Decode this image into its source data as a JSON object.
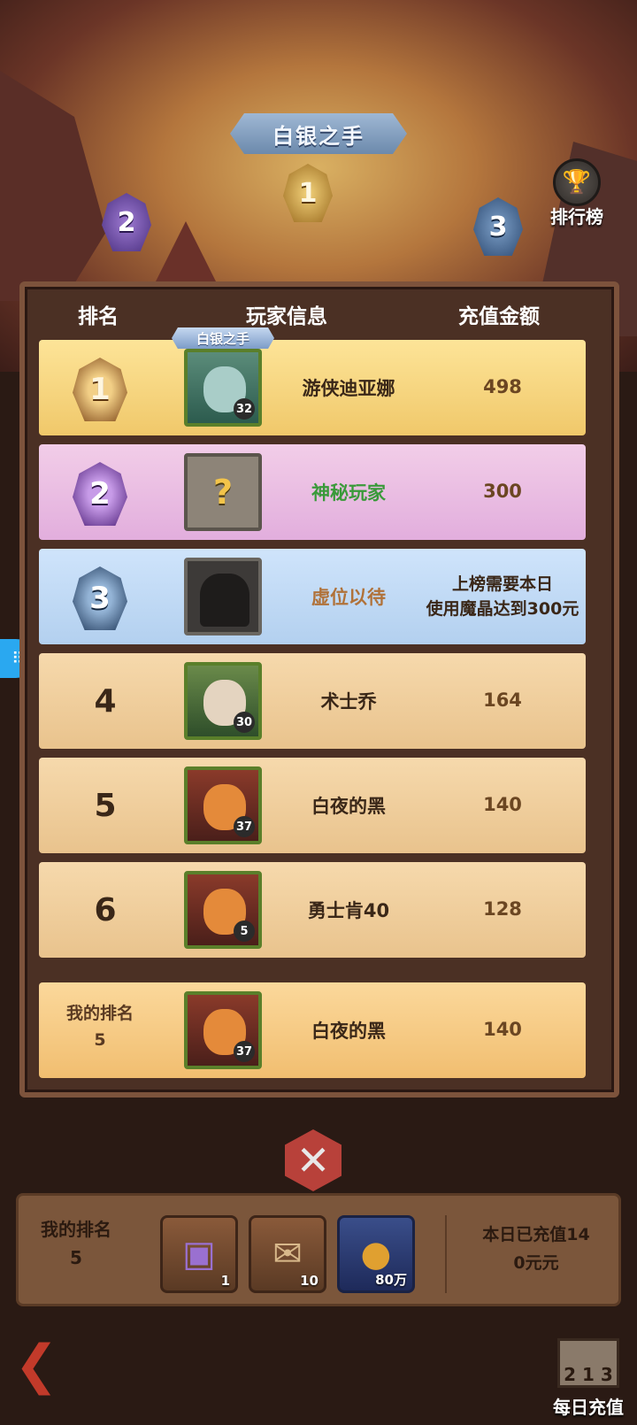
{
  "header": {
    "banner": "白银之手",
    "podium_ranks": [
      "1",
      "2",
      "3"
    ],
    "leaderboard_label": "排行榜"
  },
  "table": {
    "columns": [
      "排名",
      "玩家信息",
      "充值金额"
    ],
    "rows": [
      {
        "rank": "1",
        "name": "游侠迪亚娜",
        "amount": "498",
        "level": "32",
        "title": "白银之手"
      },
      {
        "rank": "2",
        "name": "神秘玩家",
        "amount": "300",
        "avatar": "?"
      },
      {
        "rank": "3",
        "name": "虚位以待",
        "amount_line1": "上榜需要本日",
        "amount_line2": "使用魔晶达到300元"
      },
      {
        "rank": "4",
        "name": "术士乔",
        "amount": "164",
        "level": "30"
      },
      {
        "rank": "5",
        "name": "白夜的黑",
        "amount": "140",
        "level": "37"
      },
      {
        "rank": "6",
        "name": "勇士肯40",
        "amount": "128",
        "level": "5"
      }
    ],
    "mine": {
      "label": "我的排名",
      "rank": "5",
      "name": "白夜的黑",
      "amount": "140",
      "level": "37"
    }
  },
  "rewards": {
    "my_rank_label": "我的排名",
    "my_rank": "5",
    "items": [
      {
        "icon": "card-pack-icon",
        "count": "1"
      },
      {
        "icon": "scroll-icon",
        "count": "10"
      },
      {
        "icon": "gold-coin-icon",
        "count": "80万"
      }
    ],
    "today_line1": "本日已充值14",
    "today_line2": "0元元"
  },
  "nav": {
    "daily_label": "每日充值",
    "daily_podium": "2 1 3"
  },
  "colors": {
    "panel_border": "#7d533c",
    "row_gold": "#f0c86a",
    "row_purple": "#e2aedd",
    "row_blue": "#b3d0ef",
    "row_tan": "#e9c38d",
    "name_green": "#3a9a3a",
    "name_brown": "#b0723a"
  }
}
